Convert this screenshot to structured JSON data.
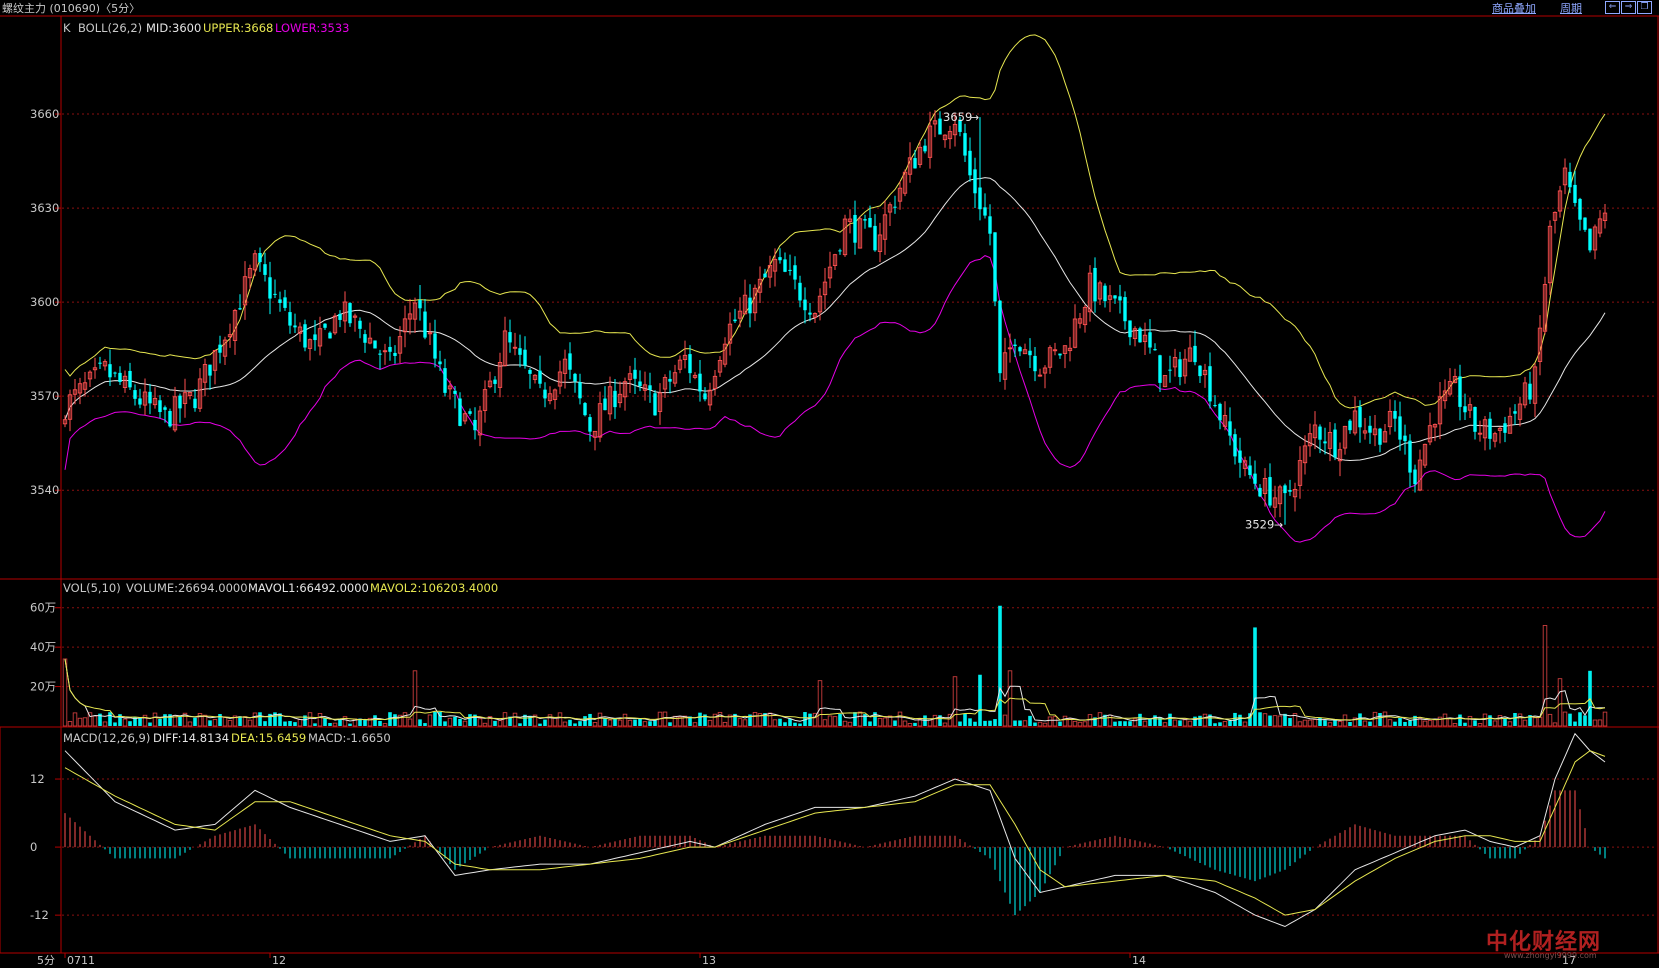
{
  "window": {
    "title": "螺纹主力 (010690)〈5分〉",
    "overlay_button": "商品叠加",
    "period_button": "周期",
    "window_buttons": [
      "arrow-left-icon",
      "arrow-right-icon",
      "restore-icon"
    ]
  },
  "colors": {
    "background": "#000000",
    "frame": "#b40000",
    "grid": "#8a1010",
    "up": "#ff5050",
    "down": "#00ffff",
    "mid_line": "#e6e6e6",
    "upper_line": "#e6e650",
    "lower_line": "#e600e6",
    "volume_up": "#c83c3c",
    "volume_down": "#00f0f0",
    "macd_pos": "#ff5050",
    "macd_neg": "#00ffff",
    "axis_text": "#c8c8c8"
  },
  "price_panel": {
    "label": "K",
    "indicator": "BOLL(26,2)",
    "mid": "MID:3600",
    "upper": "UPPER:3668",
    "lower": "LOWER:3533",
    "high_mark": "3659",
    "low_mark": "3529"
  },
  "volume_panel": {
    "indicator": "VOL(5,10)",
    "volume": "VOLUME:26694.0000",
    "mavol1": "MAVOL1:66492.0000",
    "mavol2": "MAVOL2:106203.4000"
  },
  "macd_panel": {
    "indicator": "MACD(12,26,9)",
    "diff": "DIFF:14.8134",
    "dea": "DEA:15.6459",
    "macd": "MACD:-1.6650"
  },
  "x_axis": {
    "period_label": "5分",
    "first_label": "0711"
  },
  "watermark": {
    "brand": "中化财经网",
    "url": "www.zhongyi9999.com"
  },
  "chart_data": [
    {
      "type": "candlestick",
      "title": "K BOLL(26,2)",
      "ylim": [
        3512,
        3690
      ],
      "yticks": [
        3540,
        3570,
        3600,
        3630,
        3660
      ],
      "x_ticks": [
        {
          "index": 0,
          "label": "0711"
        },
        {
          "index": 41,
          "label": "12"
        },
        {
          "index": 127,
          "label": "13"
        },
        {
          "index": 213,
          "label": "14"
        },
        {
          "index": 299,
          "label": "17"
        }
      ],
      "anchors": {
        "count": 309,
        "close_index": [
          0,
          8,
          14,
          20,
          26,
          32,
          38,
          45,
          50,
          55,
          60,
          65,
          70,
          76,
          82,
          88,
          95,
          100,
          105,
          112,
          118,
          124,
          128,
          132,
          137,
          142,
          150,
          156,
          162,
          168,
          172,
          178,
          181,
          183,
          185,
          187,
          190,
          195,
          200,
          205,
          210,
          215,
          220,
          226,
          232,
          236,
          240,
          244,
          247,
          250,
          254,
          258,
          262,
          266,
          270,
          274,
          278,
          282,
          286,
          290,
          294,
          297,
          300,
          302,
          305,
          308
        ],
        "close_value": [
          3567,
          3578,
          3570,
          3563,
          3570,
          3590,
          3612,
          3593,
          3585,
          3597,
          3590,
          3580,
          3601,
          3572,
          3558,
          3588,
          3570,
          3580,
          3560,
          3575,
          3568,
          3582,
          3570,
          3590,
          3600,
          3612,
          3598,
          3625,
          3620,
          3640,
          3652,
          3659,
          3640,
          3632,
          3622,
          3575,
          3590,
          3580,
          3585,
          3605,
          3598,
          3590,
          3575,
          3585,
          3560,
          3546,
          3540,
          3536,
          3548,
          3560,
          3555,
          3564,
          3558,
          3562,
          3545,
          3565,
          3572,
          3560,
          3558,
          3565,
          3575,
          3622,
          3640,
          3628,
          3616,
          3630
        ]
      },
      "boll": {
        "period": 26,
        "k": 2,
        "mid": 3600,
        "upper": 3668,
        "lower": 3533,
        "high": {
          "index": 183,
          "value": 3659
        },
        "low": {
          "index": 244,
          "value": 3529
        }
      }
    },
    {
      "type": "bar",
      "title": "VOL(5,10)",
      "yticks": [
        {
          "value": 200000,
          "label": "20万"
        },
        {
          "value": 400000,
          "label": "40万"
        },
        {
          "value": 600000,
          "label": "60万"
        }
      ],
      "ylim": [
        0,
        700000
      ],
      "baseline": 40000,
      "spikes": [
        {
          "index": 0,
          "value": 340000
        },
        {
          "index": 70,
          "value": 280000
        },
        {
          "index": 151,
          "value": 230000
        },
        {
          "index": 178,
          "value": 250000
        },
        {
          "index": 183,
          "value": 260000
        },
        {
          "index": 187,
          "value": 610000
        },
        {
          "index": 189,
          "value": 280000
        },
        {
          "index": 238,
          "value": 500000
        },
        {
          "index": 296,
          "value": 510000
        },
        {
          "index": 299,
          "value": 240000
        },
        {
          "index": 305,
          "value": 280000
        }
      ]
    },
    {
      "type": "line",
      "title": "MACD(12,26,9)",
      "ylim": [
        -18.5,
        21
      ],
      "yticks": [
        -12,
        0,
        12
      ],
      "diff_anchors": {
        "index": [
          0,
          10,
          22,
          30,
          38,
          45,
          55,
          65,
          72,
          78,
          85,
          95,
          105,
          115,
          125,
          130,
          140,
          150,
          160,
          170,
          178,
          185,
          190,
          195,
          200,
          210,
          220,
          230,
          238,
          244,
          250,
          258,
          266,
          274,
          280,
          285,
          290,
          295,
          298,
          302,
          305,
          308
        ],
        "value": [
          17,
          8,
          3,
          4,
          10,
          7,
          4,
          1,
          2,
          -5,
          -4,
          -3,
          -3,
          -1,
          1,
          0,
          4,
          7,
          7,
          9,
          12,
          10,
          -2,
          -8,
          -7,
          -5,
          -5,
          -8,
          -12,
          -14,
          -11,
          -4,
          -1,
          2,
          3,
          1,
          0,
          2,
          12,
          20,
          17,
          15
        ]
      },
      "dea_anchors": {
        "index": [
          0,
          10,
          22,
          30,
          38,
          45,
          55,
          65,
          72,
          78,
          85,
          95,
          105,
          115,
          125,
          130,
          140,
          150,
          160,
          170,
          178,
          185,
          190,
          195,
          200,
          210,
          220,
          230,
          238,
          244,
          250,
          258,
          266,
          274,
          280,
          285,
          290,
          295,
          298,
          302,
          305,
          308
        ],
        "value": [
          14,
          9,
          4,
          3,
          8,
          8,
          5,
          2,
          1,
          -3,
          -4,
          -4,
          -3,
          -2,
          0,
          0,
          3,
          6,
          7,
          8,
          11,
          11,
          4,
          -4,
          -7,
          -6,
          -5,
          -6,
          -9,
          -12,
          -11,
          -6,
          -2,
          1,
          2,
          2,
          1,
          1,
          7,
          15,
          17,
          16
        ]
      }
    }
  ]
}
